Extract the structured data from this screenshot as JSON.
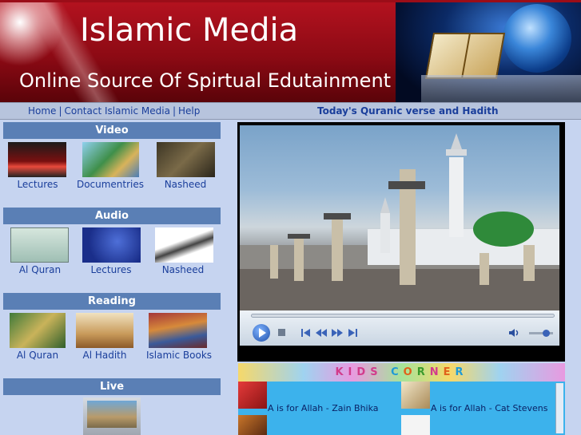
{
  "banner": {
    "title": "Islamic Media",
    "subtitle": "Online Source Of Spirtual Edutainment"
  },
  "nav": {
    "links": [
      "Home",
      "Contact Islamic Media",
      "Help"
    ],
    "separator": "|",
    "verse_link": "Today's Quranic verse and Hadith"
  },
  "sections": {
    "video": {
      "heading": "Video",
      "items": [
        "Lectures",
        "Documentries",
        "Nasheed"
      ]
    },
    "audio": {
      "heading": "Audio",
      "items": [
        "Al Quran",
        "Lectures",
        "Nasheed"
      ]
    },
    "reading": {
      "heading": "Reading",
      "items": [
        "Al Quran",
        "Al Hadith",
        "Islamic Books"
      ]
    },
    "live": {
      "heading": "Live"
    }
  },
  "player": {
    "progress": 0.0,
    "volume": 0.7
  },
  "kids": {
    "title": "KIDS CORNER",
    "letters": [
      "K",
      "I",
      "D",
      "S",
      " ",
      "C",
      "O",
      "R",
      "N",
      "E",
      "R"
    ],
    "letter_colors": [
      "#d23b8c",
      "#d23b8c",
      "#d23b8c",
      "#d23b8c",
      "#000000",
      "#1e9ad6",
      "#e0611b",
      "#3a9a2c",
      "#d23b8c",
      "#e0611b",
      "#1e9ad6"
    ],
    "items": [
      "A is for Allah - Zain Bhika",
      "A is for Allah - Cat Stevens"
    ]
  },
  "colors": {
    "banner_red": "#9b0d18",
    "nav_bg": "#b7c4dd",
    "section_head": "#5a7fb5",
    "column_bg": "#c6d4f0",
    "link": "#1a3e9b",
    "kids_bg": "#3cb2ec"
  }
}
